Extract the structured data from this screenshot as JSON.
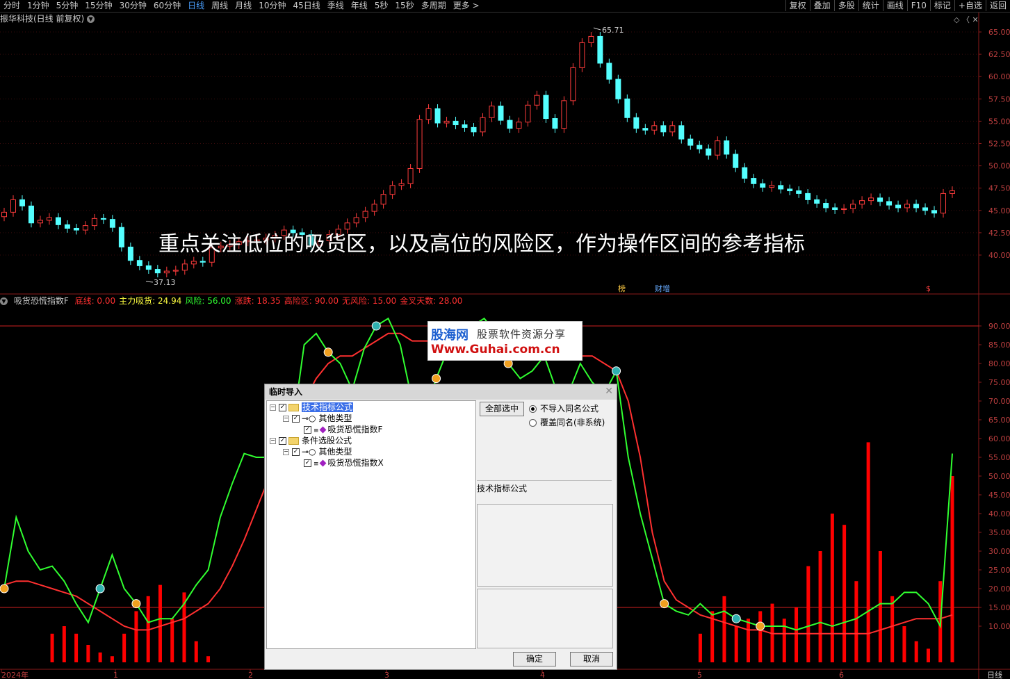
{
  "periods": [
    "分时",
    "1分钟",
    "5分钟",
    "15分钟",
    "30分钟",
    "60分钟",
    "日线",
    "周线",
    "月线",
    "10分钟",
    "45日线",
    "季线",
    "年线",
    "5秒",
    "15秒",
    "多周期",
    "更多 >"
  ],
  "active_period": "日线",
  "tools": [
    "复权",
    "叠加",
    "多股",
    "统计",
    "画线",
    "F10",
    "标记",
    "+自选",
    "返回"
  ],
  "stock": {
    "title": "振华科技(日线 前复权)",
    "high_label": "65.71",
    "low_label": "37.13",
    "marker_1": "榜",
    "marker_2": "财增",
    "marker_3": "$"
  },
  "price_axis": [
    "65.00",
    "62.50",
    "60.00",
    "57.50",
    "55.00",
    "52.50",
    "50.00",
    "47.50",
    "45.00",
    "42.50",
    "40.00"
  ],
  "indicator": {
    "name": "吸货恐慌指数F",
    "items": [
      {
        "label": "底线: 0.00",
        "color": "#ff3030"
      },
      {
        "label": "主力吸货: 24.94",
        "color": "#ffff40"
      },
      {
        "label": "风险: 56.00",
        "color": "#30ff30"
      },
      {
        "label": "涨跌: 18.35",
        "color": "#ff3030"
      },
      {
        "label": "高险区: 90.00",
        "color": "#ff3030"
      },
      {
        "label": "无风险: 15.00",
        "color": "#ff3030"
      },
      {
        "label": "金叉天数: 28.00",
        "color": "#ff3030"
      }
    ]
  },
  "ind_axis": [
    "90.00",
    "85.00",
    "80.00",
    "75.00",
    "70.00",
    "65.00",
    "60.00",
    "55.00",
    "50.00",
    "45.00",
    "40.00",
    "35.00",
    "30.00",
    "25.00",
    "20.00",
    "15.00",
    "10.00"
  ],
  "date_axis": [
    "2024年",
    "1",
    "2",
    "3",
    "4",
    "5",
    "6"
  ],
  "period_label": "日线",
  "overlay_text": "重点关注低位的吸货区，以及高位的风险区，作为操作区间的参考指标",
  "watermark": {
    "brand": "股海网",
    "slogan": "股票软件资源分享",
    "url": "Www.Guhai.com.cn"
  },
  "dialog": {
    "title": "临时导入",
    "tree": [
      {
        "label": "技术指标公式",
        "level": 0,
        "type": "folder",
        "selected": true
      },
      {
        "label": "其他类型",
        "level": 1,
        "type": "group"
      },
      {
        "label": "吸货恐慌指数F",
        "level": 2,
        "type": "item"
      },
      {
        "label": "条件选股公式",
        "level": 0,
        "type": "folder"
      },
      {
        "label": "其他类型",
        "level": 1,
        "type": "group"
      },
      {
        "label": "吸货恐慌指数X",
        "level": 2,
        "type": "item"
      }
    ],
    "select_all": "全部选中",
    "option_1": "不导入同名公式",
    "option_2": "覆盖同名(非系统)",
    "desc": "技术指标公式",
    "ok": "确定",
    "cancel": "取消"
  },
  "chart_data": [
    {
      "type": "candlestick",
      "title": "振华科技(日线 前复权)",
      "ylim": [
        37.13,
        65.71
      ],
      "annotations": {
        "high": 65.71,
        "low": 37.13
      }
    },
    {
      "type": "line",
      "title": "吸货恐慌指数F",
      "ylim": [
        0,
        95
      ],
      "reference_lines": [
        90,
        15
      ],
      "series": [
        {
          "name": "风险",
          "color": "#30ff30",
          "values": [
            20,
            39,
            30,
            25,
            26,
            22,
            16,
            11,
            20,
            29,
            20,
            16,
            11,
            12,
            12,
            16,
            21,
            25,
            39,
            48,
            56,
            55,
            55,
            55,
            62,
            85,
            88,
            83,
            80,
            73,
            84,
            90,
            92,
            85,
            70,
            66,
            76,
            84,
            86,
            90,
            92,
            88,
            80,
            76,
            78,
            82,
            73,
            72,
            80,
            75,
            72,
            78,
            55,
            40,
            28,
            16,
            14,
            13,
            16,
            13,
            14,
            12,
            11,
            10,
            10,
            10,
            9,
            10,
            11,
            10,
            11,
            12,
            14,
            16,
            16,
            19,
            19,
            16,
            10,
            56
          ]
        },
        {
          "name": "主力吸货",
          "color": "#ff3030",
          "values": [
            21,
            22,
            22,
            21,
            20,
            19,
            18,
            16,
            14,
            12,
            10,
            9,
            9,
            10,
            11,
            12,
            14,
            16,
            20,
            26,
            33,
            41,
            49,
            56,
            63,
            70,
            76,
            80,
            82,
            82,
            84,
            86,
            88,
            88,
            86,
            86,
            86,
            87,
            87,
            88,
            88,
            87,
            85,
            84,
            83,
            82,
            82,
            82,
            82,
            82,
            80,
            78,
            70,
            55,
            35,
            22,
            17,
            15,
            13,
            12,
            11,
            10,
            9,
            9,
            8,
            8,
            8,
            8,
            8,
            8,
            8,
            8,
            8,
            9,
            10,
            11,
            12,
            12,
            12,
            13
          ]
        },
        {
          "name": "涨跌",
          "color": "#ff0000",
          "values": [
            0,
            0,
            0,
            0,
            8,
            10,
            8,
            5,
            3,
            2,
            8,
            14,
            18,
            21,
            12,
            19,
            6,
            2,
            0,
            0,
            0,
            0,
            0,
            0,
            0,
            0,
            0,
            0,
            0,
            0,
            0,
            0,
            0,
            0,
            0,
            0,
            0,
            0,
            0,
            0,
            0,
            0,
            0,
            0,
            0,
            0,
            0,
            0,
            0,
            0,
            0,
            0,
            0,
            0,
            0,
            0,
            0,
            0,
            8,
            14,
            18,
            10,
            12,
            14,
            16,
            12,
            15,
            26,
            30,
            40,
            37,
            22,
            59,
            30,
            18,
            10,
            6,
            4,
            22,
            50
          ]
        }
      ]
    }
  ]
}
